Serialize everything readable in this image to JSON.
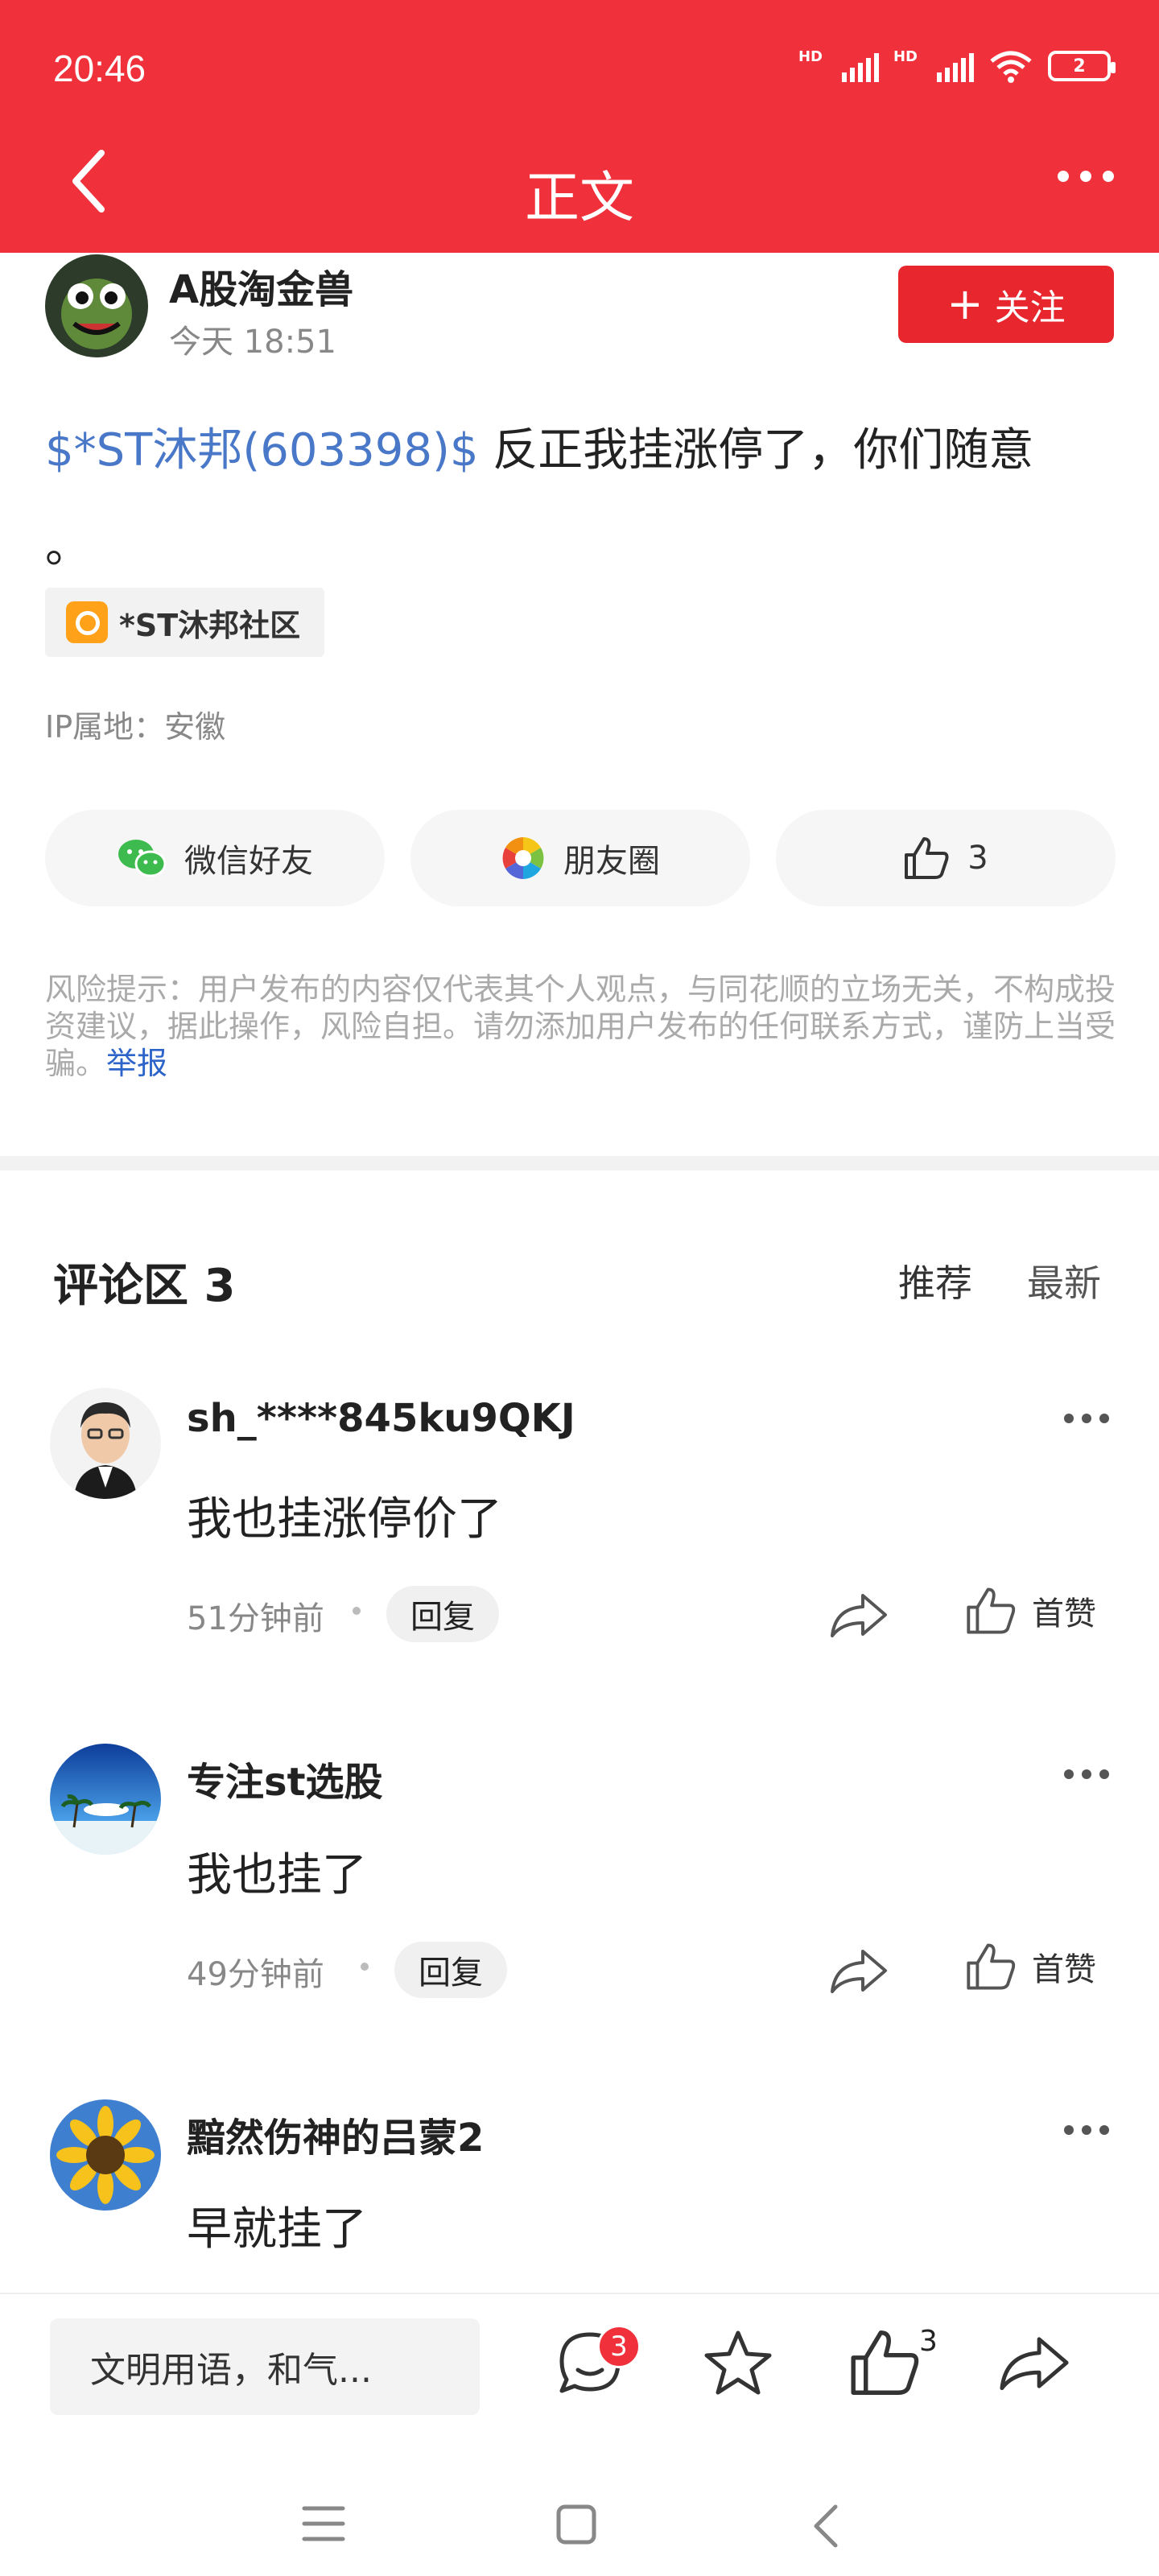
{
  "status_bar": {
    "time": "20:46",
    "hd1": "HD",
    "hd2": "HD",
    "battery": "2"
  },
  "header": {
    "title": "正文"
  },
  "post": {
    "author": "A股淘金兽",
    "time": "今天 18:51",
    "follow_label": "关注",
    "stock_tag": "$*ST沐邦(603398)$",
    "text_line1": " 反正我挂涨停了，你们随意",
    "text_line2": "。",
    "community": "*ST沐邦社区",
    "ip": "IP属地：安徽",
    "share": {
      "wechat": "微信好友",
      "moments": "朋友圈",
      "like_count": "3"
    },
    "risk_text": "风险提示：用户发布的内容仅代表其个人观点，与同花顺的立场无关，不构成投资建议，据此操作，风险自担。请勿添加用户发布的任何联系方式，谨防上当受骗。",
    "report": "举报"
  },
  "comments_section": {
    "title": "评论区 3",
    "sort_recommend": "推荐",
    "sort_latest": "最新",
    "items": [
      {
        "name": "sh_****845ku9QKJ",
        "text": "我也挂涨停价了",
        "time": "51分钟前",
        "reply": "回复",
        "like": "首赞"
      },
      {
        "name": "专注st选股",
        "text": "我也挂了",
        "time": "49分钟前",
        "reply": "回复",
        "like": "首赞"
      },
      {
        "name": "黯然伤神的吕蒙2",
        "text": "早就挂了"
      }
    ]
  },
  "bottom_bar": {
    "input_placeholder": "文明用语，和气...",
    "comment_badge": "3",
    "like_count": "3"
  },
  "icons": [
    "back-icon",
    "more-icon",
    "wechat-icon",
    "moments-icon",
    "thumb-up-icon",
    "share-icon",
    "comment-icon",
    "star-icon",
    "menu-icon",
    "home-icon"
  ],
  "colors": {
    "brand_red": "#f0313b",
    "stock_blue": "#4a78c8",
    "link_blue": "#2d64c9"
  }
}
